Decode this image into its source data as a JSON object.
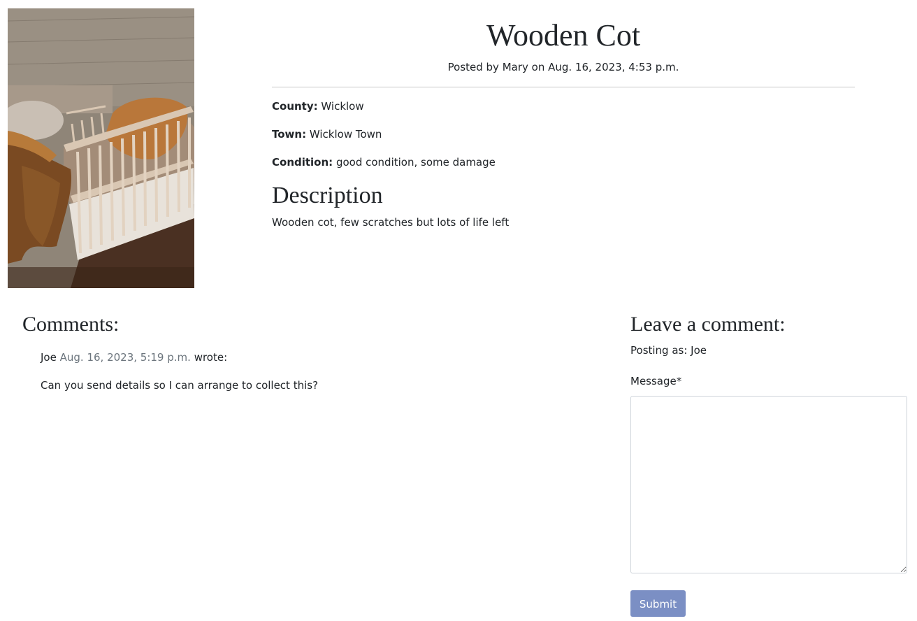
{
  "post": {
    "title": "Wooden Cot",
    "posted_line": "Posted by Mary on Aug. 16, 2023, 4:53 p.m.",
    "county_label": "County:",
    "county_value": "Wicklow",
    "town_label": "Town:",
    "town_value": "Wicklow Town",
    "condition_label": "Condition:",
    "condition_value": "good condition, some damage",
    "description_heading": "Description",
    "description_text": "Wooden cot, few scratches but lots of life left",
    "image_icon": "cot-photo"
  },
  "comments": {
    "heading": "Comments:",
    "items": [
      {
        "author": "Joe",
        "date": "Aug. 16, 2023, 5:19 p.m.",
        "suffix": "wrote:",
        "body": "Can you send details so I can arrange to collect this?"
      }
    ]
  },
  "comment_form": {
    "heading": "Leave a comment:",
    "posting_as": "Posting as: Joe",
    "message_label": "Message*",
    "message_value": "",
    "submit_label": "Submit"
  },
  "colors": {
    "text": "#212529",
    "muted": "#6c757d",
    "submit_bg": "#7b8fc4",
    "rule": "#c7c7c7"
  }
}
